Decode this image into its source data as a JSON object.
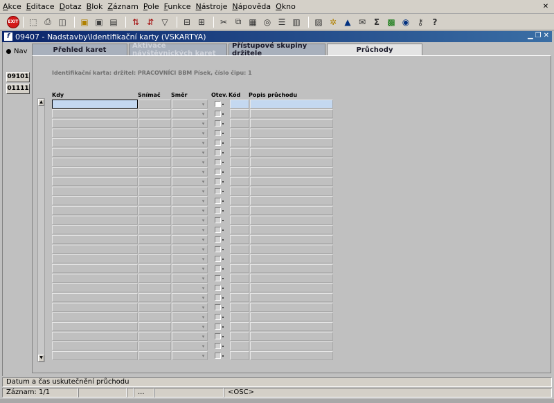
{
  "menu": [
    "Akce",
    "Editace",
    "Dotaz",
    "Blok",
    "Záznam",
    "Pole",
    "Funkce",
    "Nástroje",
    "Nápověda",
    "Okno"
  ],
  "toolbar": {
    "exit_label": "EXIT",
    "icons": [
      "save-icon",
      "print-icon",
      "find-icon",
      "insert-record-icon",
      "delete-record-icon",
      "lock-icon",
      "sort-asc-icon",
      "sort-desc-icon",
      "filter-icon",
      "clear-icon",
      "cut-icon",
      "copy-icon",
      "paste-icon",
      "search-icon",
      "list-icon",
      "columns-icon",
      "calc-icon",
      "settings-icon",
      "chart-icon",
      "mail-icon",
      "sum-icon",
      "excel-icon",
      "word-icon",
      "key-icon",
      "help-icon"
    ]
  },
  "form": {
    "title": "09407 - Nadstavby\\Identifikační karty (VSKARTYA)",
    "nav_label": "Nav",
    "side_buttons": [
      "09101",
      "01111"
    ],
    "tabs": [
      {
        "label": "Přehled karet",
        "state": "normal"
      },
      {
        "label": "Aktivace návštěvnických karet",
        "state": "disabled"
      },
      {
        "label": "Přístupové skupiny držitele",
        "state": "normal"
      },
      {
        "label": "Průchody",
        "state": "active"
      }
    ],
    "ident_line": "Identifikační karta:  držitel: PRACOVNÍCI BBM Písek, číslo čipu: 1",
    "columns": [
      "Kdy",
      "Snímač",
      "Směr",
      "Otev.",
      "Kód",
      "Popis průchodu"
    ],
    "row_count": 27
  },
  "status": {
    "hint": "Datum a čas uskutečnění průchodu",
    "record": "Záznam: 1/1",
    "cell2": "",
    "cell3": "...",
    "cell4": "",
    "mode": "<OSC>"
  }
}
